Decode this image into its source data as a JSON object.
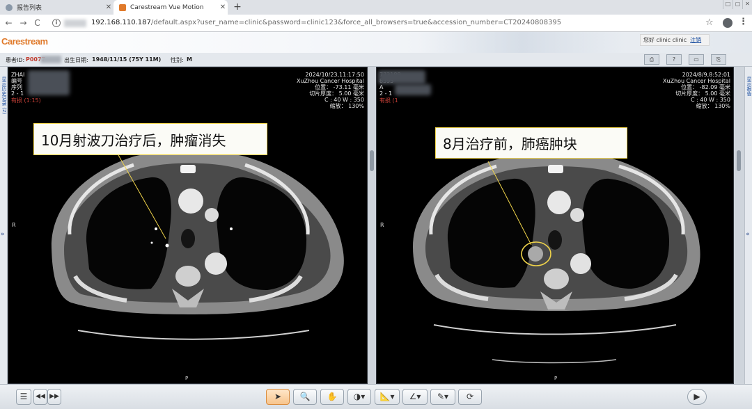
{
  "browser": {
    "tabs": [
      {
        "label": "报告列表",
        "active": false
      },
      {
        "label": "Carestream Vue Motion",
        "active": true
      }
    ],
    "new_tab": "+",
    "window_controls": [
      "□",
      "▢",
      "✕"
    ],
    "nav": {
      "back": "←",
      "forward": "→",
      "reload": "C",
      "info": "i"
    },
    "url_host": "192.168.110.187",
    "url_rest": "/default.aspx?user_name=clinic&password=clinic123&force_all_browsers=true&accession_number=CT20240808395"
  },
  "app": {
    "brand": "Carestream",
    "brand_color": "#e07a2b",
    "user_greeting": "您好 clinic clinic",
    "logout_label": "注销"
  },
  "patient": {
    "id_label": "患者ID:",
    "id_value": "P0077",
    "dob_label": "出生日期:",
    "dob_value": "1948/11/15 (75Y 11M)",
    "sex_label": "性别:",
    "sex_value": "M",
    "tools": [
      "⎙",
      "?",
      "▭",
      "⎘"
    ]
  },
  "rails": {
    "left_label": "显示历史记录 (2)",
    "right_label": "显示报告",
    "left_arrow": "»",
    "right_arrow": "«"
  },
  "viewports": [
    {
      "name_prefix": "ZHAI",
      "line2": "编号",
      "line3": "序列",
      "line4": "2 - 1",
      "status": "有损 (1:15)",
      "date": "2024/10/23,11:17:50",
      "hospital": "XuZhou Cancer Hospital",
      "position": "位置： -73.11 毫米",
      "thickness": "切片厚度： 5.00 毫米",
      "window": "C : 40 W : 350",
      "zoom": "缩放： 130%",
      "annotation": "10月射波刀治疗后，肿瘤消失",
      "side_right": "R",
      "side_bottom": "P"
    },
    {
      "name_suffix": "773188",
      "line2": "8395",
      "line3": "A",
      "line4": "2 - 1",
      "status": "有损 (1",
      "date": "2024/8/9,8:52:01",
      "hospital": "XuZhou Cancer Hospital",
      "position": "位置： -82.09 毫米",
      "thickness": "切片厚度： 5.00 毫米",
      "window": "C : 40 W : 350",
      "zoom": "缩放： 130%",
      "annotation": "8月治疗前，肺癌肿块",
      "side_right": "R",
      "side_bottom": "P"
    }
  ],
  "toolbar": {
    "list": "☰",
    "prev": "◀◀",
    "next": "▶▶",
    "pointer": "➤",
    "zoom": "🔍",
    "pan": "✋",
    "window": "◑▾",
    "measure": "📐▾",
    "angle": "∠▾",
    "annotate": "✎▾",
    "reset": "⟳",
    "play": "▶"
  }
}
